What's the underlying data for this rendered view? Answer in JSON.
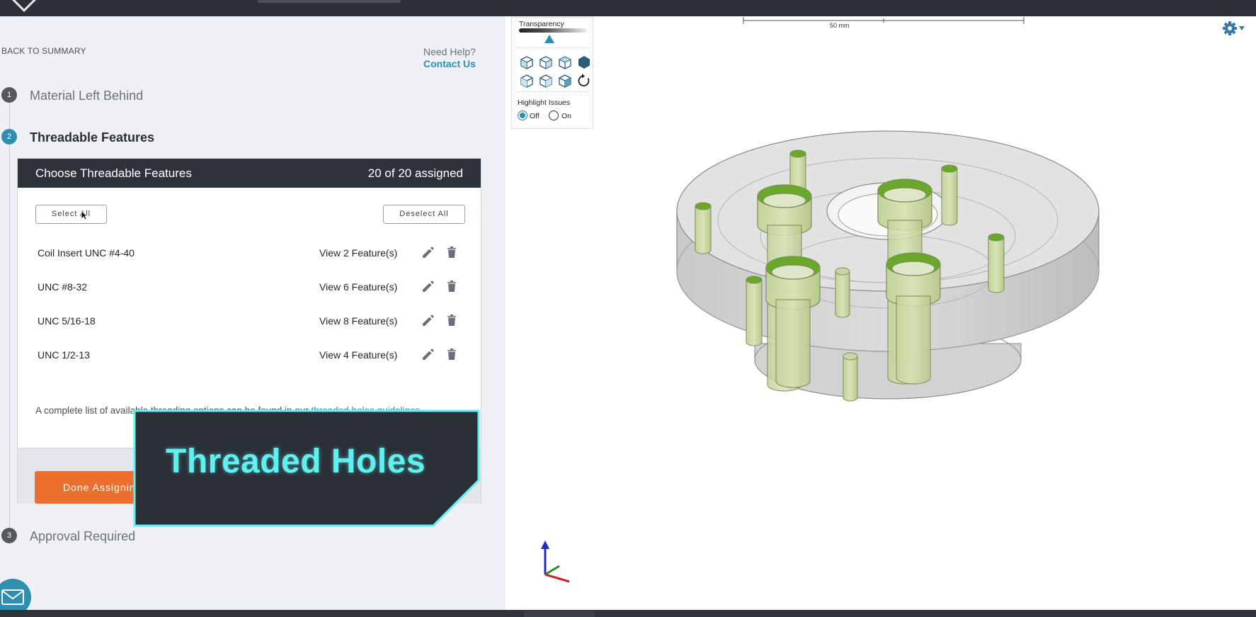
{
  "nav": {
    "back_label": "BACK TO SUMMARY",
    "help_label": "Need Help?",
    "contact_label": "Contact Us"
  },
  "steps": [
    {
      "number": "1",
      "label": "Material Left Behind"
    },
    {
      "number": "2",
      "label": "Threadable Features"
    },
    {
      "number": "3",
      "label": "Approval Required"
    }
  ],
  "card": {
    "title": "Choose Threadable Features",
    "count": "20 of 20 assigned",
    "select_all_label": "Select All",
    "deselect_all_label": "Deselect All",
    "rows": [
      {
        "name": "Coil Insert UNC #4-40",
        "view": "View 2 Feature(s)"
      },
      {
        "name": "UNC #8-32",
        "view": "View 6 Feature(s)"
      },
      {
        "name": "UNC 5/16-18",
        "view": "View 8 Feature(s)"
      },
      {
        "name": "UNC 1/2-13",
        "view": "View 4 Feature(s)"
      }
    ],
    "note_prefix": "A complete list of available threading options can be found in our ",
    "note_link": "threaded holes guidelines",
    "done_label": "Done Assigning"
  },
  "overlay": {
    "title": "Threaded Holes"
  },
  "viewer": {
    "transparency_label": "Transparency",
    "transparency_value": 0.45,
    "highlight_label": "Highlight Issues",
    "highlight_off": "Off",
    "highlight_on": "On",
    "highlight_selected": "Off",
    "scale_label": "50 mm",
    "view_icons": [
      "view-iso-1-icon",
      "view-iso-2-icon",
      "view-iso-3-icon",
      "view-solid-icon",
      "view-front-icon",
      "view-side-icon",
      "view-top-icon",
      "reset-rotation-icon"
    ]
  },
  "colors": {
    "accent": "#2f8fb0",
    "dark": "#2d323b",
    "orange": "#ec6f2d",
    "overlay_text": "#5ff0f0",
    "hole_green": "#6aa82a"
  }
}
